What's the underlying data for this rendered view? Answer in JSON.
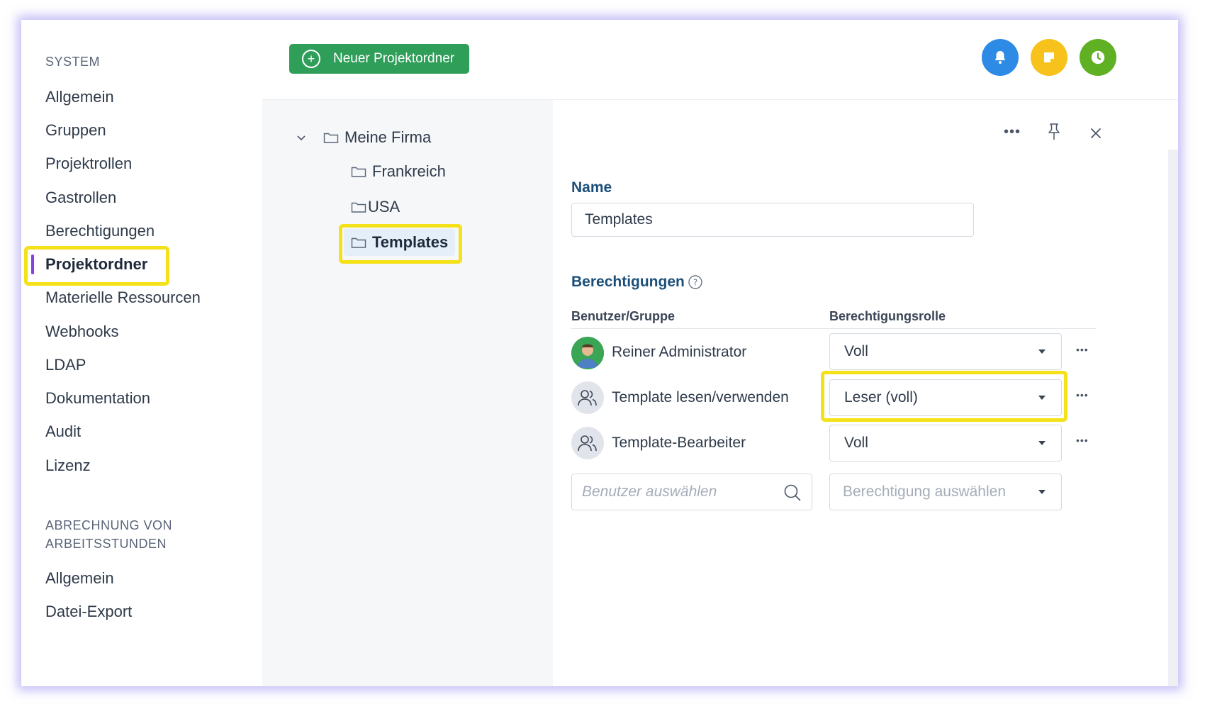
{
  "sidebar": {
    "section1_title": "SYSTEM",
    "items": [
      {
        "label": "Allgemein"
      },
      {
        "label": "Gruppen"
      },
      {
        "label": "Projektrollen"
      },
      {
        "label": "Gastrollen"
      },
      {
        "label": "Berechtigungen"
      },
      {
        "label": "Projektordner",
        "active": true
      },
      {
        "label": "Materielle Ressourcen"
      },
      {
        "label": "Webhooks"
      },
      {
        "label": "LDAP"
      },
      {
        "label": "Dokumentation"
      },
      {
        "label": "Audit"
      },
      {
        "label": "Lizenz"
      }
    ],
    "section2_title_line1": "ABRECHNUNG VON",
    "section2_title_line2": "ARBEITSSTUNDEN",
    "items2": [
      {
        "label": "Allgemein"
      },
      {
        "label": "Datei-Export"
      }
    ]
  },
  "header": {
    "new_folder_label": "Neuer Projektordner",
    "buttons": [
      {
        "name": "notification",
        "icon": "bell-icon",
        "color": "#2d8be6"
      },
      {
        "name": "notes",
        "icon": "note-icon",
        "color": "#f6c21b"
      },
      {
        "name": "time",
        "icon": "clock-icon",
        "color": "#5fb023"
      }
    ]
  },
  "tree": {
    "root": "Meine Firma",
    "children": [
      "Frankreich",
      "USA",
      "Templates"
    ],
    "selected": "Templates"
  },
  "detail": {
    "name_label": "Name",
    "name_value": "Templates",
    "permissions_label": "Berechtigungen",
    "col_user": "Benutzer/Gruppe",
    "col_role": "Berechtigungsrolle",
    "rows": [
      {
        "name": "Reiner Administrator",
        "role": "Voll",
        "type": "user"
      },
      {
        "name": "Template lesen/verwenden",
        "role": "Leser (voll)",
        "type": "group"
      },
      {
        "name": "Template-Bearbeiter",
        "role": "Voll",
        "type": "group"
      }
    ],
    "user_placeholder": "Benutzer auswählen",
    "role_placeholder": "Berechtigung auswählen"
  },
  "colors": {
    "accent_green": "#2e9e59",
    "active_bar": "#8a3ee0",
    "highlight": "#f5e11a",
    "label_blue": "#1b4f7a"
  }
}
